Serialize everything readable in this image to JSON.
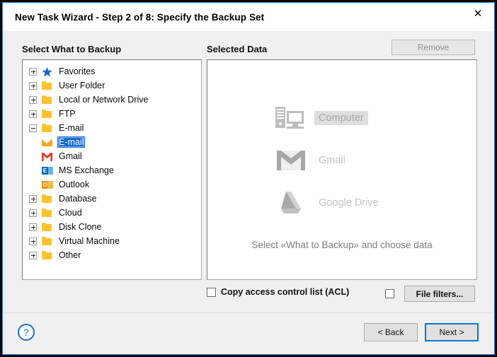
{
  "window": {
    "title": "New Task Wizard - Step 2 of 8: Specify the Backup Set",
    "close_label": "✕",
    "border_color": "#2b7cd3"
  },
  "left_panel": {
    "heading": "Select What to Backup",
    "tree": [
      {
        "label": "Favorites",
        "icon": "star-icon",
        "expander": "plus",
        "level": 0,
        "selected": false
      },
      {
        "label": "User Folder",
        "icon": "folder-icon",
        "expander": "plus",
        "level": 0,
        "selected": false
      },
      {
        "label": "Local or Network Drive",
        "icon": "folder-icon",
        "expander": "plus",
        "level": 0,
        "selected": false
      },
      {
        "label": "FTP",
        "icon": "folder-icon",
        "expander": "plus",
        "level": 0,
        "selected": false
      },
      {
        "label": "E-mail",
        "icon": "folder-icon",
        "expander": "minus",
        "level": 0,
        "selected": false
      },
      {
        "label": "E-mail",
        "icon": "envelope-icon",
        "expander": "none",
        "level": 1,
        "selected": true
      },
      {
        "label": "Gmail",
        "icon": "gmail-icon",
        "expander": "none",
        "level": 1,
        "selected": false
      },
      {
        "label": "MS Exchange",
        "icon": "ms-exchange-icon",
        "expander": "none",
        "level": 1,
        "selected": false
      },
      {
        "label": "Outlook",
        "icon": "outlook-icon",
        "expander": "none",
        "level": 1,
        "selected": false
      },
      {
        "label": "Database",
        "icon": "folder-icon",
        "expander": "plus",
        "level": 0,
        "selected": false
      },
      {
        "label": "Cloud",
        "icon": "folder-icon",
        "expander": "plus",
        "level": 0,
        "selected": false
      },
      {
        "label": "Disk Clone",
        "icon": "folder-icon",
        "expander": "plus",
        "level": 0,
        "selected": false
      },
      {
        "label": "Virtual Machine",
        "icon": "folder-icon",
        "expander": "plus",
        "level": 0,
        "selected": false
      },
      {
        "label": "Other",
        "icon": "folder-icon",
        "expander": "plus",
        "level": 0,
        "selected": false
      }
    ],
    "selection_color": "#1669d3",
    "folder_color": "#fdc22f"
  },
  "right_panel": {
    "heading": "Selected Data",
    "remove_button": "Remove",
    "remove_enabled": false,
    "watermark_items": [
      {
        "label": "Computer",
        "icon": "computer-icon",
        "highlighted": true
      },
      {
        "label": "Gmail",
        "icon": "gmail-icon",
        "highlighted": false
      },
      {
        "label": "Google Drive",
        "icon": "google-drive-icon",
        "highlighted": false
      }
    ],
    "hint": "Select «What to Backup» and choose data"
  },
  "options": {
    "acl_label": "Copy access control list (ACL)",
    "acl_checked": false,
    "filters_checked": false,
    "filters_button": "File filters..."
  },
  "footer": {
    "help_icon": "help-icon",
    "back_button": "< Back",
    "next_button": "Next >",
    "focus_color": "#0078d7"
  }
}
